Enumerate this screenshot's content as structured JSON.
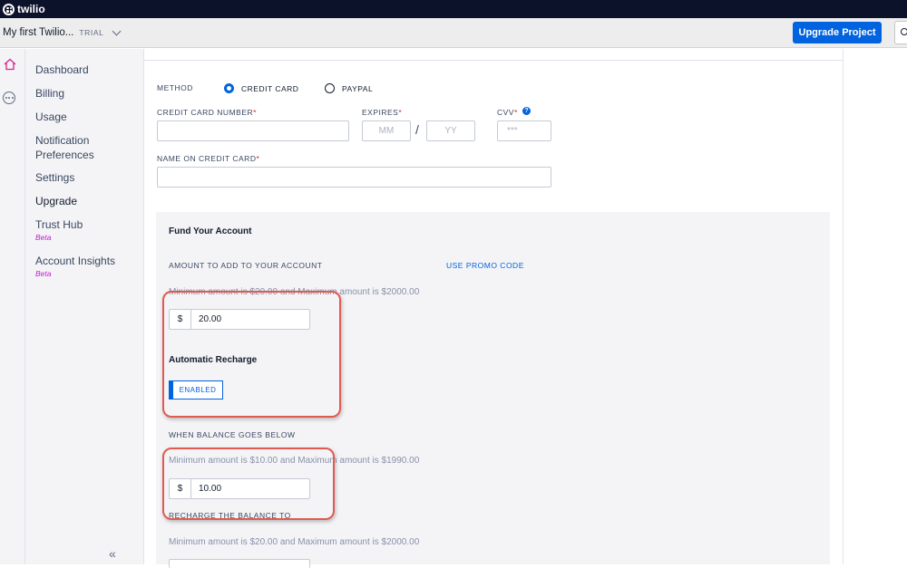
{
  "brand": {
    "logo_text": "twilio"
  },
  "header": {
    "account_name": "My first Twilio...",
    "account_badge": "TRIAL",
    "upgrade_label": "Upgrade Project"
  },
  "sidebar": {
    "items": [
      {
        "label": "Dashboard",
        "beta": ""
      },
      {
        "label": "Billing",
        "beta": ""
      },
      {
        "label": "Usage",
        "beta": ""
      },
      {
        "label": "Notification Preferences",
        "beta": ""
      },
      {
        "label": "Settings",
        "beta": ""
      },
      {
        "label": "Upgrade",
        "beta": ""
      },
      {
        "label": "Trust Hub",
        "beta": "Beta"
      },
      {
        "label": "Account Insights",
        "beta": "Beta"
      }
    ],
    "collapse_glyph": "«"
  },
  "payment": {
    "method_label": "METHOD",
    "credit_card_label": "CREDIT CARD",
    "paypal_label": "PAYPAL",
    "selected_method": "CREDIT CARD",
    "card_number_label": "CREDIT CARD NUMBER",
    "expires_label": "EXPIRES",
    "expires_mm_placeholder": "MM",
    "expires_separator": "/",
    "expires_yy_placeholder": "YY",
    "cvv_label": "CVV",
    "cvv_placeholder": "***",
    "name_label": "NAME ON CREDIT CARD",
    "required_mark": "*",
    "help_glyph": "?"
  },
  "fund": {
    "title": "Fund Your Account",
    "amount_label": "AMOUNT TO ADD TO YOUR ACCOUNT",
    "promo_label": "USE PROMO CODE",
    "amount_hint": "Minimum amount is $20.00 and Maximum amount is $2000.00",
    "currency": "$",
    "amount_value": "20.00",
    "auto_recharge_title": "Automatic Recharge",
    "auto_recharge_state": "ENABLED",
    "balance_below_label": "WHEN BALANCE GOES BELOW",
    "balance_below_hint": "Minimum amount is $10.00 and Maximum amount is $1990.00",
    "balance_below_value": "10.00",
    "recharge_to_label": "RECHARGE THE BALANCE TO",
    "recharge_to_hint": "Minimum amount is $20.00 and Maximum amount is $2000.00"
  },
  "colors": {
    "accent": "#0263e0",
    "topbar": "#0d122b",
    "highlight": "#e05a52",
    "beta": "#c21cd1"
  }
}
